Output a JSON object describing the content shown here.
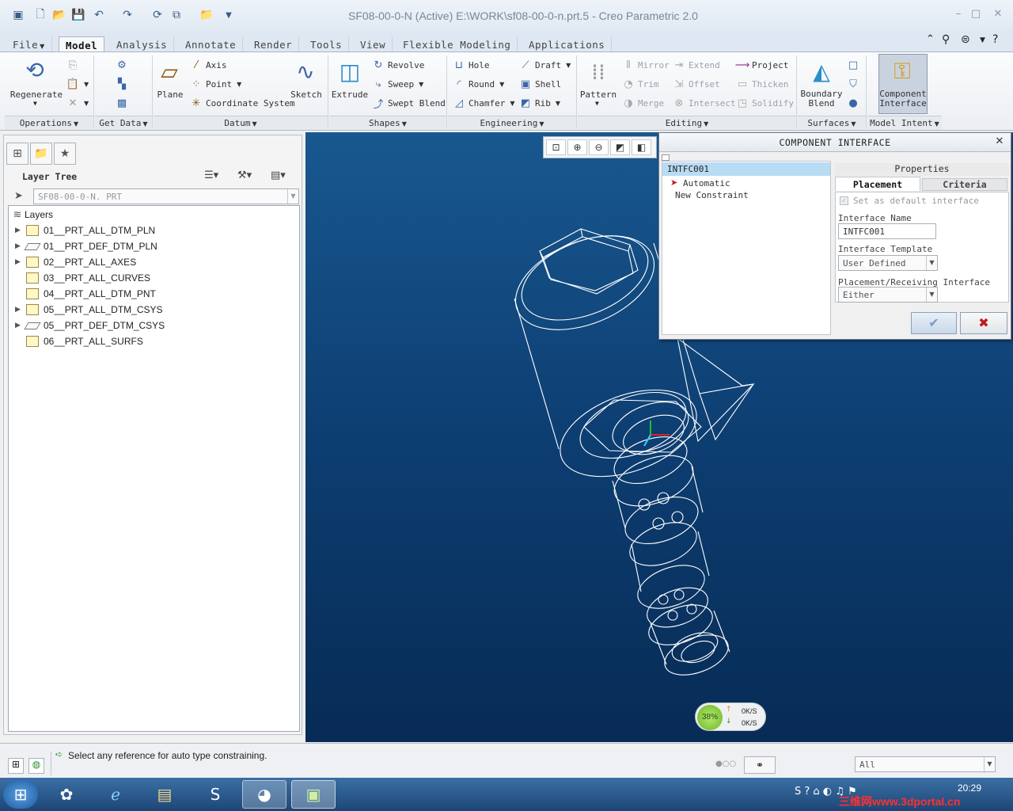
{
  "window": {
    "title": "SF08-00-0-N (Active) E:\\WORK\\sf08-00-0-n.prt.5 - Creo Parametric 2.0",
    "controls": [
      "–",
      "□",
      "✕"
    ]
  },
  "tabs": [
    "File",
    "Model",
    "Analysis",
    "Annotate",
    "Render",
    "Tools",
    "View",
    "Flexible Modeling",
    "Applications"
  ],
  "active_tab": "Model",
  "ribbon": {
    "operations": {
      "regenerate": "Regenerate",
      "group": "Operations"
    },
    "get_data": {
      "group": "Get Data"
    },
    "datum": {
      "plane": "Plane",
      "axis": "Axis",
      "point": "Point",
      "csys": "Coordinate System",
      "sketch": "Sketch",
      "group": "Datum"
    },
    "shapes": {
      "extrude": "Extrude",
      "revolve": "Revolve",
      "sweep": "Sweep",
      "swept_blend": "Swept Blend",
      "group": "Shapes"
    },
    "engineering": {
      "hole": "Hole",
      "round": "Round",
      "chamfer": "Chamfer",
      "draft": "Draft",
      "shell": "Shell",
      "rib": "Rib",
      "group": "Engineering"
    },
    "editing": {
      "pattern": "Pattern",
      "mirror": "Mirror",
      "trim": "Trim",
      "merge": "Merge",
      "extend": "Extend",
      "offset": "Offset",
      "intersect": "Intersect",
      "project": "Project",
      "thicken": "Thicken",
      "solidify": "Solidify",
      "group": "Editing"
    },
    "surfaces": {
      "boundary_blend_1": "Boundary",
      "boundary_blend_2": "Blend",
      "group": "Surfaces"
    },
    "model_intent": {
      "component_interface_1": "Component",
      "component_interface_2": "Interface",
      "group": "Model Intent"
    }
  },
  "left_panel": {
    "title": "Layer Tree",
    "model_selector": "SF08-00-0-N. PRT",
    "root": "Layers",
    "layers": [
      {
        "name": "01__PRT_ALL_DTM_PLN",
        "expandable": true,
        "kind": "layer"
      },
      {
        "name": "01__PRT_DEF_DTM_PLN",
        "expandable": true,
        "kind": "plane"
      },
      {
        "name": "02__PRT_ALL_AXES",
        "expandable": true,
        "kind": "layer"
      },
      {
        "name": "03__PRT_ALL_CURVES",
        "expandable": false,
        "kind": "layer"
      },
      {
        "name": "04__PRT_ALL_DTM_PNT",
        "expandable": false,
        "kind": "layer"
      },
      {
        "name": "05__PRT_ALL_DTM_CSYS",
        "expandable": true,
        "kind": "layer"
      },
      {
        "name": "05__PRT_DEF_DTM_CSYS",
        "expandable": true,
        "kind": "plane"
      },
      {
        "name": "06__PRT_ALL_SURFS",
        "expandable": false,
        "kind": "layer"
      }
    ]
  },
  "dialog": {
    "title": "COMPONENT INTERFACE",
    "interface_item": "INTFC001",
    "constraint_type": "Automatic",
    "new_constraint": "New Constraint",
    "properties_header": "Properties",
    "tab_placement": "Placement",
    "tab_criteria": "Criteria",
    "default_interface": "Set as default interface",
    "interface_name_label": "Interface Name",
    "interface_name_value": "INTFC001",
    "template_label": "Interface Template",
    "template_value": "User Defined",
    "placement_label": "Placement/Receiving Interface",
    "placement_value": "Either",
    "ok_icon": "✔",
    "cancel_icon": "✖"
  },
  "net_widget": {
    "percent": "38%",
    "up": "0K/S",
    "down": "0K/S"
  },
  "status": {
    "message": "Select any reference for auto type constraining.",
    "filter": "All"
  },
  "taskbar": {
    "clock": "20:29",
    "watermark": "三维网www.3dportal.cn"
  }
}
